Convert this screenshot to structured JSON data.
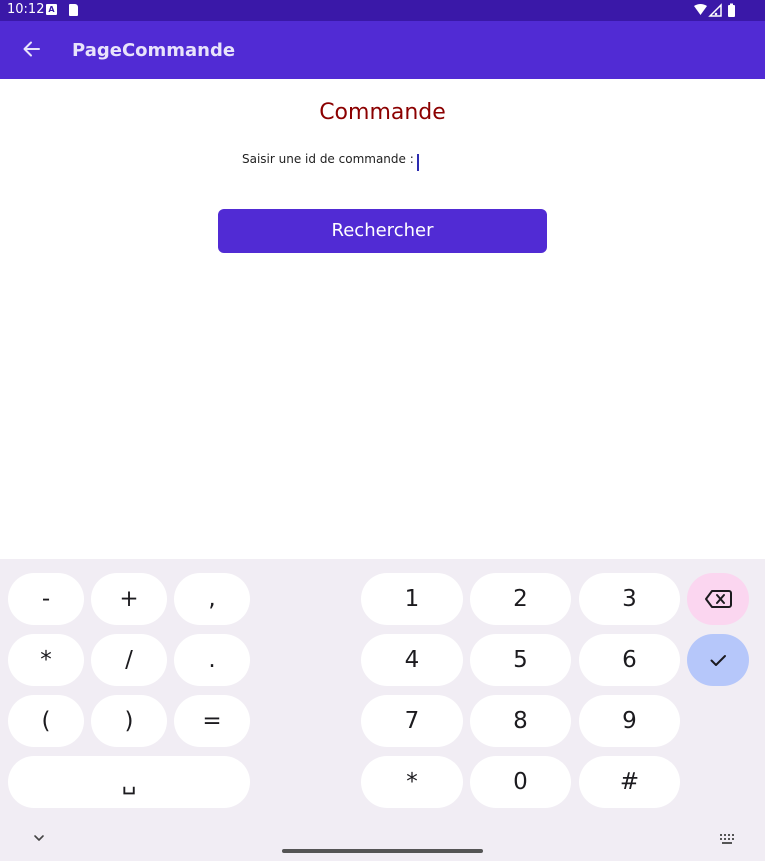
{
  "status_bar": {
    "time": "10:12",
    "input_badge": "A"
  },
  "app_bar": {
    "title": "PageCommande"
  },
  "page": {
    "heading": "Commande",
    "field_label": "Saisir une id de commande :",
    "field_value": "",
    "search_button_label": "Rechercher"
  },
  "keyboard": {
    "symbols": [
      "-",
      "+",
      ",",
      "*",
      "/",
      ".",
      "(",
      ")",
      "="
    ],
    "space_label": "␣",
    "digits": [
      "1",
      "2",
      "3",
      "4",
      "5",
      "6",
      "7",
      "8",
      "9",
      "*",
      "0",
      "#"
    ]
  },
  "colors": {
    "status_bar": "#3a18a8",
    "app_bar": "#512bd4",
    "heading": "#8b0000",
    "button": "#512bd4",
    "keyboard_bg": "#f1edf4",
    "delete_key": "#fbd6f0",
    "enter_key": "#b6c7fa"
  },
  "icons": {
    "back": "arrow-left-icon",
    "backspace": "backspace-icon",
    "enter": "check-icon",
    "collapse": "chevron-down-icon",
    "keyboard_switch": "keyboard-icon",
    "wifi": "wifi-icon",
    "signal": "signal-icon",
    "battery": "battery-icon"
  }
}
